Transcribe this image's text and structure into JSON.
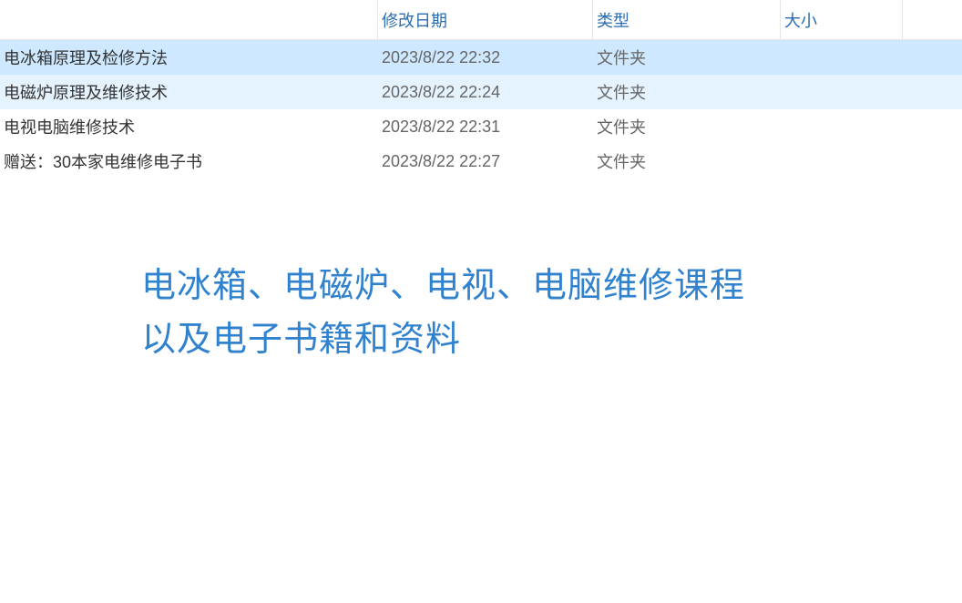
{
  "columns": {
    "name": "",
    "date": "修改日期",
    "type": "类型",
    "size": "大小"
  },
  "rows": [
    {
      "name": "电冰箱原理及检修方法",
      "date": "2023/8/22 22:32",
      "type": "文件夹",
      "size": "",
      "state": "selected"
    },
    {
      "name": "电磁炉原理及维修技术",
      "date": "2023/8/22 22:24",
      "type": "文件夹",
      "size": "",
      "state": "alt"
    },
    {
      "name": "电视电脑维修技术",
      "date": "2023/8/22 22:31",
      "type": "文件夹",
      "size": "",
      "state": ""
    },
    {
      "name": "赠送：30本家电维修电子书",
      "date": "2023/8/22 22:27",
      "type": "文件夹",
      "size": "",
      "state": ""
    }
  ],
  "caption": {
    "line1": "电冰箱、电磁炉、电视、电脑维修课程",
    "line2": "以及电子书籍和资料"
  }
}
